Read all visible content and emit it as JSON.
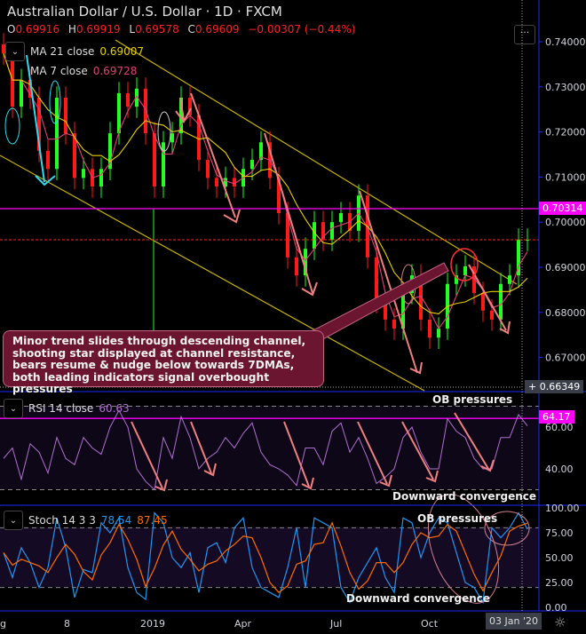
{
  "header": {
    "title": "Australian Dollar / U.S. Dollar · 1D · FXCM",
    "ohlc": {
      "o_label": "O",
      "o": "0.69916",
      "h_label": "H",
      "h": "0.69919",
      "l_label": "L",
      "l": "0.69578",
      "c_label": "C",
      "c": "0.69609",
      "change": "−0.00307 (−0.44%)"
    },
    "ma21": {
      "label": "MA 21 close",
      "value": "0.69007",
      "color": "#e8d000"
    },
    "ma7": {
      "label": "MA 7 close",
      "value": "0.69728",
      "color": "#e0407a"
    },
    "more_label": "···"
  },
  "callout": {
    "text": "Minor trend slides through descending channel, shooting star displayed at channel resistance, bears resume & nudge below towards 7DMAs, both leading indicators signal overbought pressures"
  },
  "price_axis": {
    "ticks": [
      "0.74000",
      "0.73000",
      "0.72000",
      "0.71000",
      "0.70000",
      "0.69000",
      "0.68000",
      "0.67000"
    ],
    "marker_value": "0.70314",
    "crosshair_value": "0.66349",
    "marker_color": "#ff00ff"
  },
  "rsi": {
    "label": "RSI 14 close",
    "value": "60.63",
    "ticks": [
      "60.00",
      "40.00"
    ],
    "marker_value": "64.17",
    "note_top": "OB pressures",
    "note_bottom": "Downward convergence"
  },
  "stoch": {
    "label": "Stoch 14 3 3",
    "k_value": "78.54",
    "d_value": "87.45",
    "ticks": [
      "100.00",
      "75.00",
      "50.00",
      "25.00",
      "0.00"
    ],
    "note_top": "OB pressures",
    "note_bottom": "Downward convergence"
  },
  "time_axis": {
    "ticks": [
      "g",
      "8",
      "2019",
      "Apr",
      "Jul",
      "Oct"
    ],
    "crosshair_label": "03 Jan '20"
  },
  "chart_data": [
    {
      "type": "candlestick",
      "title": "Australian Dollar / U.S. Dollar · 1D · FXCM",
      "ylim": [
        0.6635,
        0.7425
      ],
      "closes": [
        0.7374,
        0.7256,
        0.7315,
        0.7276,
        0.7158,
        0.7118,
        0.7276,
        0.7197,
        0.7098,
        0.7118,
        0.7079,
        0.7118,
        0.7197,
        0.7286,
        0.7256,
        0.7296,
        0.7197,
        0.7079,
        0.7177,
        0.7197,
        0.7276,
        0.7237,
        0.7138,
        0.7098,
        0.7079,
        0.7098,
        0.7079,
        0.7118,
        0.7138,
        0.7177,
        0.7098,
        0.702,
        0.6922,
        0.6882,
        0.6941,
        0.7,
        0.6961,
        0.7,
        0.702,
        0.6981,
        0.7059,
        0.6922,
        0.6823,
        0.6784,
        0.6764,
        0.6843,
        0.6882,
        0.6784,
        0.6744,
        0.6764,
        0.6863,
        0.6882,
        0.6902,
        0.6843,
        0.6804,
        0.6784,
        0.6863,
        0.6882,
        0.6961,
        0.6961
      ],
      "horizontal_lines": [
        {
          "value": 0.70314,
          "color": "#ff00ff",
          "style": "solid"
        },
        {
          "value": 0.6961,
          "color": "#ff2020",
          "style": "dashed"
        }
      ],
      "colors": {
        "up": "#22ff22",
        "down": "#ff1a1a"
      }
    },
    {
      "type": "line",
      "title": "RSI 14 close",
      "ylim": [
        15,
        80
      ],
      "levels": [
        70,
        30
      ],
      "values": [
        45,
        50,
        35,
        52,
        48,
        38,
        55,
        45,
        42,
        55,
        50,
        47,
        60,
        68,
        60,
        40,
        34,
        30,
        55,
        45,
        65,
        55,
        40,
        45,
        48,
        55,
        50,
        57,
        62,
        48,
        42,
        40,
        37,
        32,
        50,
        50,
        42,
        58,
        62,
        48,
        55,
        45,
        33,
        36,
        40,
        55,
        60,
        48,
        40,
        40,
        64,
        58,
        55,
        45,
        40,
        40,
        55,
        55,
        66,
        60.63
      ],
      "color": "#b070d0",
      "marker_line": 64.17
    },
    {
      "type": "line",
      "title": "Stoch 14 3 3",
      "ylim": [
        -3,
        103
      ],
      "levels": [
        80,
        20
      ],
      "series": [
        {
          "name": "%K",
          "color": "#2196f3",
          "values": [
            55,
            30,
            60,
            45,
            20,
            40,
            90,
            60,
            10,
            38,
            35,
            85,
            75,
            90,
            40,
            15,
            8,
            95,
            85,
            50,
            40,
            55,
            15,
            60,
            65,
            45,
            80,
            90,
            40,
            20,
            15,
            10,
            40,
            80,
            20,
            90,
            85,
            80,
            20,
            5,
            30,
            45,
            60,
            30,
            15,
            90,
            85,
            50,
            75,
            90,
            85,
            55,
            25,
            20,
            5,
            80,
            70,
            80,
            95,
            78.54
          ]
        }
      ],
      "d_color": "#ff6d00"
    }
  ]
}
